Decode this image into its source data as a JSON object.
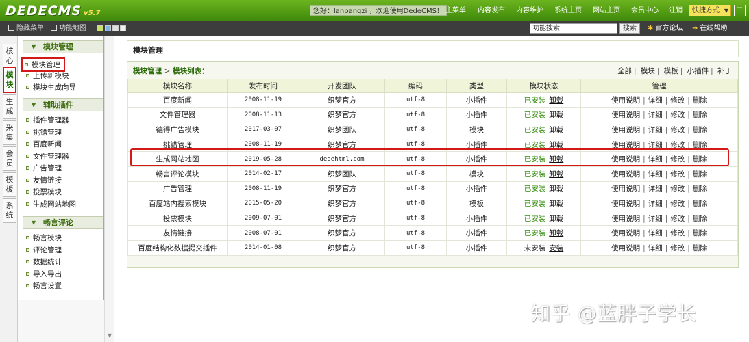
{
  "header": {
    "logo_text": "DEDECMS",
    "version": "v5.7",
    "greeting": "您好：lanpangzi ，欢迎使用DedeCMS！",
    "nav": [
      "主菜单",
      "内容发布",
      "内容维护",
      "系统主页",
      "网站主页",
      "会员中心",
      "注销"
    ],
    "quick_menu": "快捷方式",
    "quick_arrow": "▼",
    "corner_icon": "☰"
  },
  "subbar": {
    "hide_menu": "隐藏菜单",
    "site_map": "功能地图",
    "search_placeholder": "功能搜索",
    "search_button": "搜索",
    "forum": "官方论坛",
    "help": "在线帮助"
  },
  "vtabs": [
    "核心",
    "模块",
    "生成",
    "采集",
    "会员",
    "模板",
    "系统"
  ],
  "sidebar": {
    "groups": [
      {
        "title": "模块管理",
        "items": [
          "模块管理",
          "上传新模块",
          "模块生成向导"
        ]
      },
      {
        "title": "辅助插件",
        "items": [
          "插件管理器",
          "挑错管理",
          "百度新闻",
          "文件管理器",
          "广告管理",
          "友情链接",
          "投票模块",
          "生成网站地图"
        ]
      },
      {
        "title": "畅言评论",
        "items": [
          "畅言模块",
          "评论管理",
          "数据统计",
          "导入导出",
          "畅言设置"
        ]
      }
    ]
  },
  "main": {
    "panel_title": "模块管理",
    "crumb_root": "模块管理",
    "crumb_sep": ">",
    "crumb_current": "模块列表：",
    "filters": [
      "全部",
      "模块",
      "模板",
      "小插件",
      "补丁"
    ],
    "columns": [
      "模块名称",
      "发布时间",
      "开发团队",
      "编码",
      "类型",
      "模块状态",
      "管理"
    ],
    "manage_links": [
      "使用说明",
      "详细",
      "修改",
      "删除"
    ],
    "rows": [
      {
        "name": "百度新闻",
        "date": "2008-11-19",
        "team": "织梦官方",
        "enc": "utf-8",
        "type": "小插件",
        "status": "已安装",
        "action": "卸载"
      },
      {
        "name": "文件管理器",
        "date": "2008-11-13",
        "team": "织梦官方",
        "enc": "utf-8",
        "type": "小插件",
        "status": "已安装",
        "action": "卸载"
      },
      {
        "name": "德得广告模块",
        "date": "2017-03-07",
        "team": "织梦团队",
        "enc": "utf-8",
        "type": "模块",
        "status": "已安装",
        "action": "卸载"
      },
      {
        "name": "挑错管理",
        "date": "2008-11-19",
        "team": "织梦官方",
        "enc": "utf-8",
        "type": "小插件",
        "status": "已安装",
        "action": "卸载"
      },
      {
        "name": "生成网站地图",
        "date": "2019-05-28",
        "team": "dedehtml.com",
        "enc": "utf-8",
        "type": "小插件",
        "status": "已安装",
        "action": "卸载"
      },
      {
        "name": "畅言评论模块",
        "date": "2014-02-17",
        "team": "织梦团队",
        "enc": "utf-8",
        "type": "模块",
        "status": "已安装",
        "action": "卸载"
      },
      {
        "name": "广告管理",
        "date": "2008-11-19",
        "team": "织梦官方",
        "enc": "utf-8",
        "type": "小插件",
        "status": "已安装",
        "action": "卸载"
      },
      {
        "name": "百度站内搜索模块",
        "date": "2015-05-20",
        "team": "织梦官方",
        "enc": "utf-8",
        "type": "模板",
        "status": "已安装",
        "action": "卸载"
      },
      {
        "name": "投票模块",
        "date": "2009-07-01",
        "team": "织梦官方",
        "enc": "utf-8",
        "type": "小插件",
        "status": "已安装",
        "action": "卸载"
      },
      {
        "name": "友情链接",
        "date": "2008-07-01",
        "team": "织梦官方",
        "enc": "utf-8",
        "type": "小插件",
        "status": "已安装",
        "action": "卸载"
      },
      {
        "name": "百度结构化数据提交插件",
        "date": "2014-01-08",
        "team": "织梦官方",
        "enc": "utf-8",
        "type": "小插件",
        "status": "未安装",
        "action": "安装"
      }
    ]
  },
  "watermark": "知乎 @蓝胖子学长",
  "colors": {
    "brand_green": "#4f9a12",
    "highlight_red": "#d31818",
    "status_installed": "#2f8a08"
  }
}
